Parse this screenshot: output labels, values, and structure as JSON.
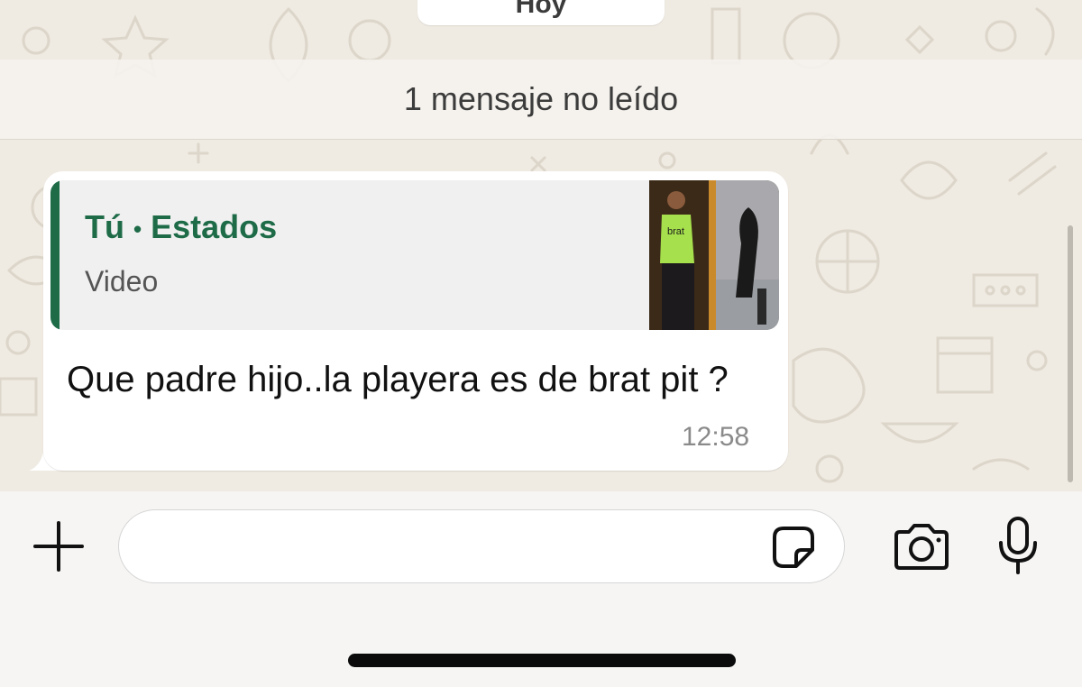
{
  "chat": {
    "date_label": "Hoy",
    "unread_banner": "1 mensaje no leído"
  },
  "message": {
    "quote": {
      "author": "Tú",
      "separator": "•",
      "source": "Estados",
      "media_type": "Video",
      "thumbnail_caption": "brat"
    },
    "text": "Que padre hijo..la playera es de brat pit ?",
    "time": "12:58"
  },
  "composer": {
    "input_value": "",
    "icons": {
      "attach": "plus-icon",
      "sticker": "sticker-icon",
      "camera": "camera-icon",
      "mic": "microphone-icon"
    }
  },
  "colors": {
    "accent_green": "#1e6b48",
    "chat_background": "#efeae2",
    "bubble": "#ffffff",
    "quote_background": "#f0f0f0"
  }
}
